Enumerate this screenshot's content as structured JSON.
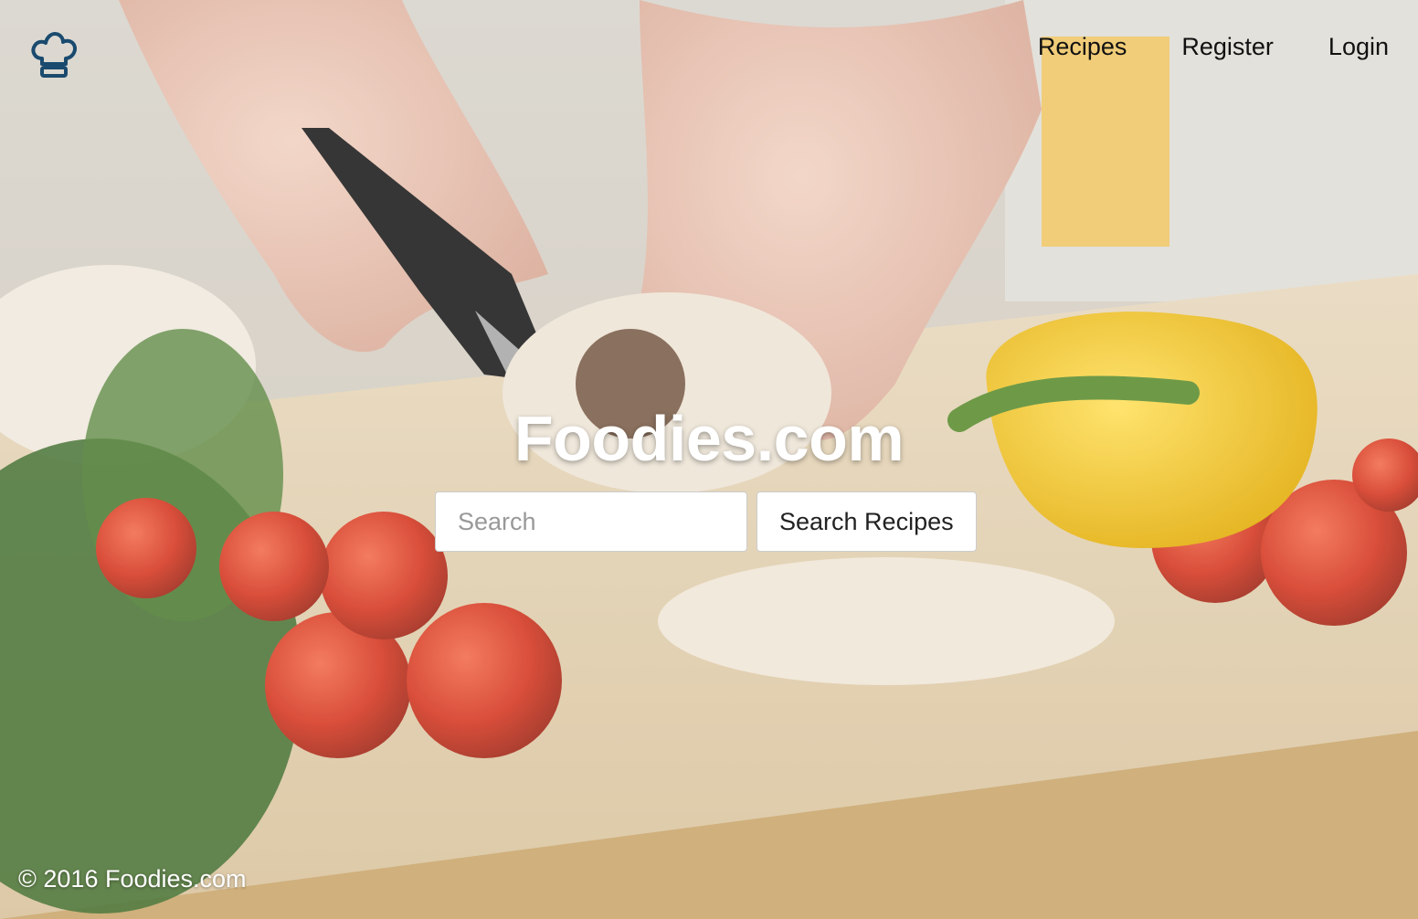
{
  "brand": {
    "logo_icon": "chef-hat-icon",
    "logo_color": "#1a4a6e"
  },
  "nav": {
    "items": [
      {
        "label": "Recipes"
      },
      {
        "label": "Register"
      },
      {
        "label": "Login"
      }
    ]
  },
  "hero": {
    "title": "Foodies.com",
    "search_placeholder": "Search",
    "search_value": "",
    "search_button": "Search Recipes"
  },
  "footer": {
    "copyright": "© 2016 Foodies.com"
  }
}
